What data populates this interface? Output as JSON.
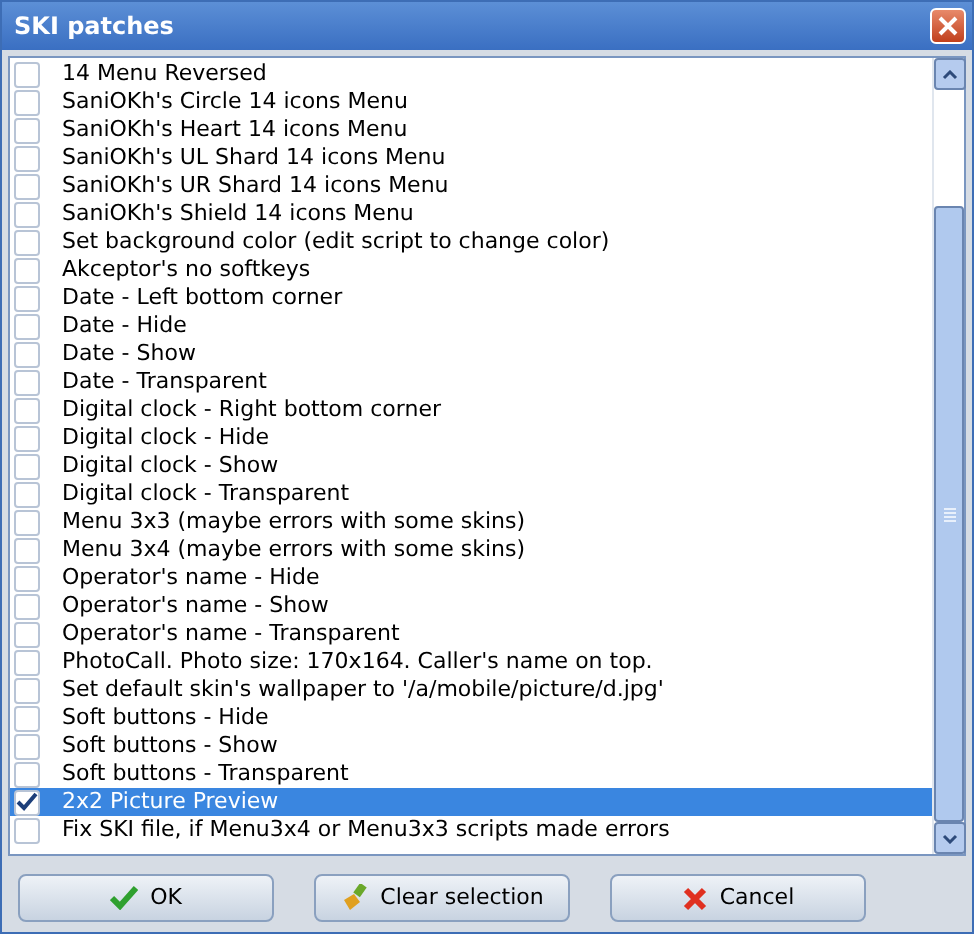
{
  "window": {
    "title": "SKI patches"
  },
  "items": [
    {
      "label": "14 Menu Reversed",
      "checked": false,
      "selected": false
    },
    {
      "label": "SaniOKh's Circle 14 icons Menu",
      "checked": false,
      "selected": false
    },
    {
      "label": "SaniOKh's Heart 14 icons Menu",
      "checked": false,
      "selected": false
    },
    {
      "label": "SaniOKh's UL Shard 14 icons Menu",
      "checked": false,
      "selected": false
    },
    {
      "label": "SaniOKh's UR Shard 14 icons Menu",
      "checked": false,
      "selected": false
    },
    {
      "label": "SaniOKh's Shield 14 icons Menu",
      "checked": false,
      "selected": false
    },
    {
      "label": "Set background color (edit script to change color)",
      "checked": false,
      "selected": false
    },
    {
      "label": "Akceptor's no softkeys",
      "checked": false,
      "selected": false
    },
    {
      "label": "Date - Left bottom corner",
      "checked": false,
      "selected": false
    },
    {
      "label": "Date - Hide",
      "checked": false,
      "selected": false
    },
    {
      "label": "Date - Show",
      "checked": false,
      "selected": false
    },
    {
      "label": "Date - Transparent",
      "checked": false,
      "selected": false
    },
    {
      "label": "Digital clock - Right bottom corner",
      "checked": false,
      "selected": false
    },
    {
      "label": "Digital clock - Hide",
      "checked": false,
      "selected": false
    },
    {
      "label": "Digital clock - Show",
      "checked": false,
      "selected": false
    },
    {
      "label": "Digital clock - Transparent",
      "checked": false,
      "selected": false
    },
    {
      "label": "Menu 3x3 (maybe errors with some skins)",
      "checked": false,
      "selected": false
    },
    {
      "label": "Menu 3x4 (maybe errors with some skins)",
      "checked": false,
      "selected": false
    },
    {
      "label": "Operator's name - Hide",
      "checked": false,
      "selected": false
    },
    {
      "label": "Operator's name - Show",
      "checked": false,
      "selected": false
    },
    {
      "label": "Operator's name - Transparent",
      "checked": false,
      "selected": false
    },
    {
      "label": "PhotoCall. Photo size: 170x164. Caller's name on top.",
      "checked": false,
      "selected": false
    },
    {
      "label": "Set default skin's wallpaper to '/a/mobile/picture/d.jpg'",
      "checked": false,
      "selected": false
    },
    {
      "label": "Soft buttons - Hide",
      "checked": false,
      "selected": false
    },
    {
      "label": "Soft buttons - Show",
      "checked": false,
      "selected": false
    },
    {
      "label": "Soft buttons - Transparent",
      "checked": false,
      "selected": false
    },
    {
      "label": "2x2 Picture Preview",
      "checked": true,
      "selected": true
    },
    {
      "label": "Fix SKI file, if Menu3x4 or Menu3x3 scripts made errors",
      "checked": false,
      "selected": false
    }
  ],
  "buttons": [
    {
      "label": "OK",
      "kind": "ok"
    },
    {
      "label": "Clear selection",
      "kind": "clear"
    },
    {
      "label": "Cancel",
      "kind": "cancel"
    }
  ]
}
